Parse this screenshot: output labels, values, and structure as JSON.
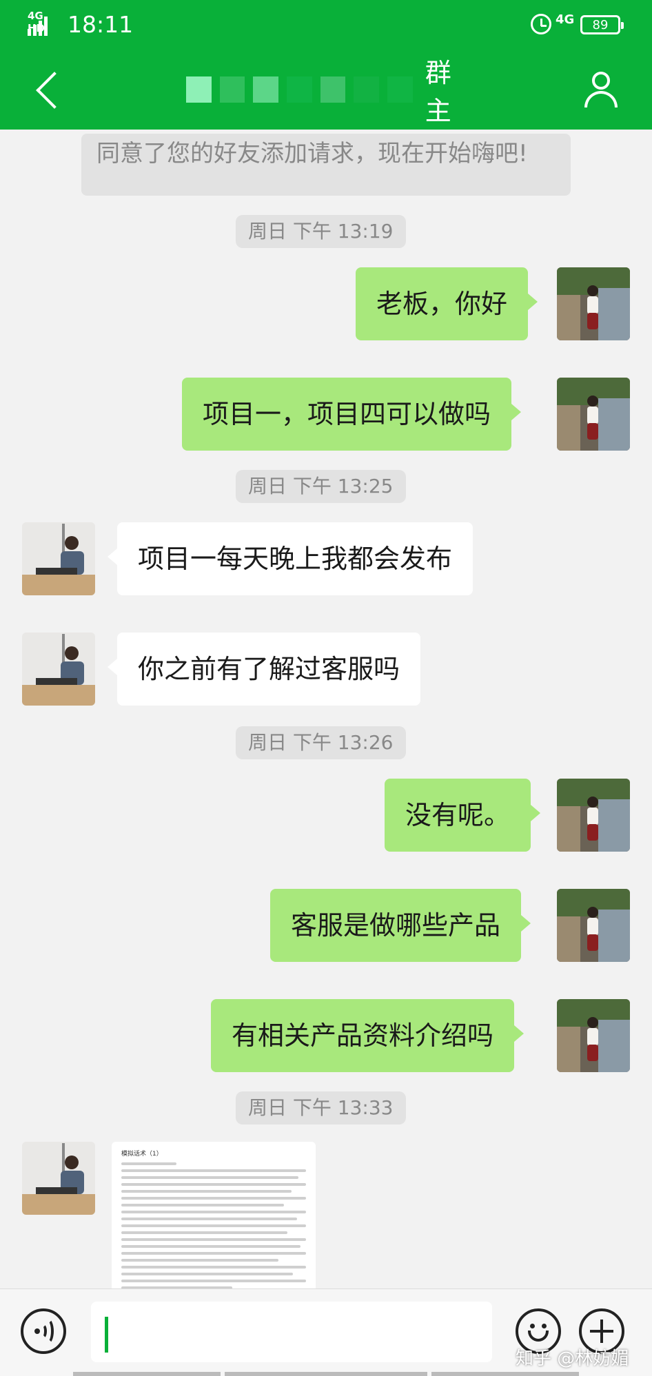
{
  "status_bar": {
    "network_tag": "4G HD",
    "time": "18:11",
    "mobile_network": "4G",
    "battery": "89"
  },
  "header": {
    "title": "群主",
    "colors": {
      "primary": "#09b039"
    }
  },
  "chat": {
    "system_message": "同意了您的好友添加请求，现在开始嗨吧!",
    "timestamps": [
      "周日 下午 13:19",
      "周日 下午 13:25",
      "周日 下午 13:26",
      "周日 下午 13:33"
    ],
    "messages": [
      {
        "sender": "me",
        "text": "老板，你好"
      },
      {
        "sender": "me",
        "text": "项目一，项目四可以做吗"
      },
      {
        "sender": "them",
        "text": "项目一每天晚上我都会发布"
      },
      {
        "sender": "them",
        "text": "你之前有了解过客服吗"
      },
      {
        "sender": "me",
        "text": "没有呢。"
      },
      {
        "sender": "me",
        "text": "客服是做哪些产品"
      },
      {
        "sender": "me",
        "text": "有相关产品资料介绍吗"
      }
    ],
    "attachment": {
      "type": "image",
      "title": "模拟话术（1）"
    }
  },
  "input_bar": {
    "icons": [
      "voice-icon",
      "emoji-icon",
      "plus-icon"
    ]
  },
  "watermark": "知乎 @林妨媚",
  "colors": {
    "my_bubble": "#a8e87c",
    "their_bubble": "#ffffff",
    "background": "#f2f2f2"
  }
}
